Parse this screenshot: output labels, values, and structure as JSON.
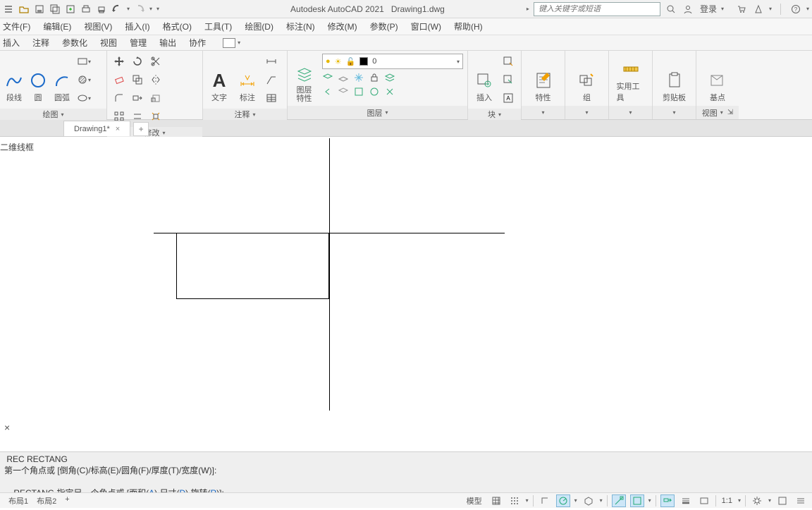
{
  "app_name": "Autodesk AutoCAD 2021",
  "file_name": "Drawing1.dwg",
  "search_placeholder": "键入关键字或短语",
  "login_label": "登录",
  "menu": [
    "文件(F)",
    "编辑(E)",
    "视图(V)",
    "插入(I)",
    "格式(O)",
    "工具(T)",
    "绘图(D)",
    "标注(N)",
    "修改(M)",
    "参数(P)",
    "窗口(W)",
    "帮助(H)"
  ],
  "ribbon_tabs": [
    "插入",
    "注释",
    "参数化",
    "视图",
    "管理",
    "输出",
    "协作"
  ],
  "panels": {
    "draw": {
      "label": "绘图",
      "line": "段线",
      "circle": "圆",
      "arc": "圆弧"
    },
    "modify": {
      "label": "修改"
    },
    "annot": {
      "label": "注释",
      "text": "文字",
      "dim": "标注"
    },
    "layers": {
      "label": "图层",
      "layerprops": "图层\n特性",
      "current": "0"
    },
    "block": {
      "label": "块",
      "insert": "插入"
    },
    "props": {
      "label": "特性"
    },
    "group": {
      "label": "组"
    },
    "util": {
      "label": "实用工具"
    },
    "clip": {
      "label": "剪贴板"
    },
    "view": {
      "label": "视图",
      "base": "基点"
    }
  },
  "file_tab": {
    "name": "Drawing1*",
    "close": "×",
    "add": "+"
  },
  "canvas_label": "二维线框",
  "close_icon": "×",
  "cmd": {
    "l1": " REC RECTANG",
    "l2_pre": "第一个角点或 [倒角(C)/标高(E)/圆角(F)/厚度(T)/宽度(W)]:",
    "l3_pre": "RECTANG 指定另一个角点或 [面积(",
    "l3_a": "A",
    "l3_mid1": ") 尺寸(",
    "l3_d": "D",
    "l3_mid2": ") 旋转(",
    "l3_r": "R",
    "l3_end": ")]:"
  },
  "status": {
    "tabs": [
      "布局1",
      "布局2"
    ],
    "add": "+",
    "model": "模型",
    "scale": "1:1"
  }
}
